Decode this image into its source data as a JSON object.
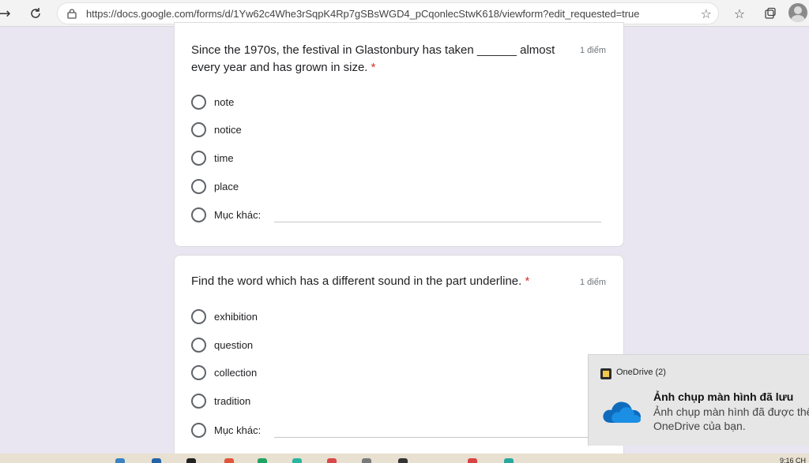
{
  "browser": {
    "url": "https://docs.google.com/forms/d/1Yw62c4Whe3rSqpK4Rp7gSBsWGD4_pCqonlecStwK618/viewform?edit_requested=true",
    "icons": [
      "back-icon",
      "reload-icon",
      "lock-icon",
      "add-favorite-icon",
      "favorites-icon",
      "collections-icon",
      "profile-icon"
    ]
  },
  "questions": [
    {
      "title": "Since the 1970s, the festival in Glastonbury has taken ______ almost every year and has grown in size.",
      "required_mark": "*",
      "points": "1 điểm",
      "options": [
        "note",
        "notice",
        "time",
        "place"
      ],
      "other_label": "Mục khác:"
    },
    {
      "title": "Find the word which has a different sound in the part underline.",
      "required_mark": "*",
      "points": "1 điểm",
      "options": [
        "exhibition",
        "question",
        "collection",
        "tradition"
      ],
      "other_label": "Mục khác:"
    }
  ],
  "notification": {
    "app": "OneDrive (2)",
    "title": "Ảnh chụp màn hình đã lưu",
    "body_line1": "Ảnh chụp màn hình đã được thêm",
    "body_line2": "OneDrive của bạn."
  },
  "taskbar": {
    "clock": "9:16 CH"
  },
  "colors": {
    "page_background": "#e9e5f1",
    "required": "#d93025",
    "onedrive_blue": "#0f6cbd"
  }
}
